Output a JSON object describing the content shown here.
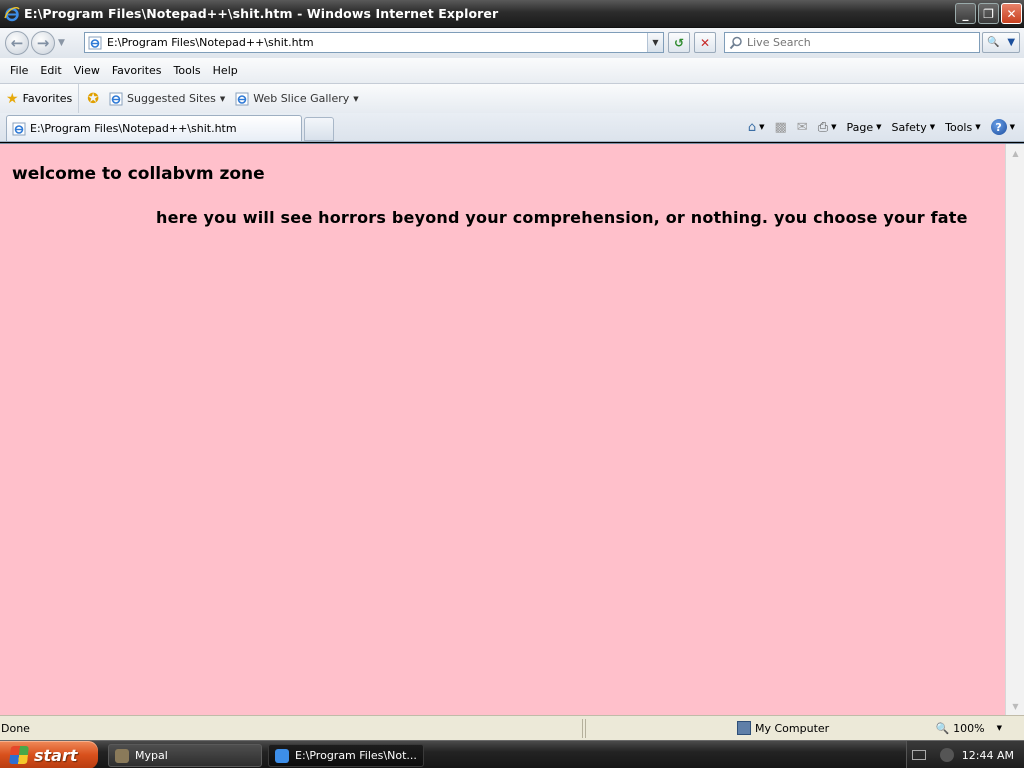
{
  "window": {
    "title": "E:\\Program Files\\Notepad++\\shit.htm - Windows Internet Explorer",
    "buttons": {
      "minimize": "_",
      "restore": "❐",
      "close": "✕"
    }
  },
  "address": {
    "url": "E:\\Program Files\\Notepad++\\shit.htm",
    "search_placeholder": "Live Search"
  },
  "menu": {
    "items": [
      "File",
      "Edit",
      "View",
      "Favorites",
      "Tools",
      "Help"
    ]
  },
  "favorites_bar": {
    "favorites_label": "Favorites",
    "links": [
      "Suggested Sites",
      "Web Slice Gallery"
    ]
  },
  "tab": {
    "label": "E:\\Program Files\\Notepad++\\shit.htm"
  },
  "command_bar": {
    "page": "Page",
    "safety": "Safety",
    "tools": "Tools"
  },
  "page": {
    "heading": "welcome to collabvm zone",
    "paragraph": "here you will see horrors beyond your comprehension, or nothing. you choose your fate",
    "background": "#ffc0cb"
  },
  "status": {
    "text": "Done",
    "zone": "My Computer",
    "zoom": "100%"
  },
  "taskbar": {
    "start_label": "start",
    "tasks": [
      "Mypal",
      "E:\\Program Files\\Not..."
    ],
    "clock": "12:44 AM"
  }
}
